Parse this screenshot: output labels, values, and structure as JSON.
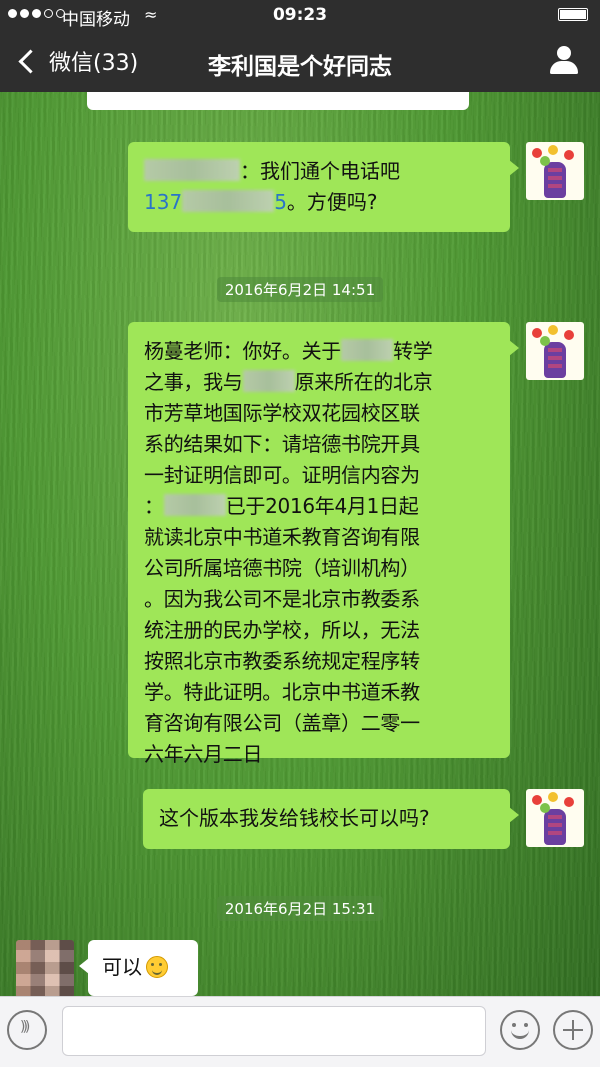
{
  "status_bar": {
    "carrier": "中国移动",
    "time": "09:23",
    "signal_strength": "3 of 5",
    "wifi_icon": "wifi-icon",
    "battery_icon": "battery-icon"
  },
  "nav": {
    "back_label": "微信(33)",
    "title": "李利国是个好同志",
    "profile_icon": "person-icon"
  },
  "messages": {
    "msg1": {
      "line1_suffix": "：我们通个电话吧",
      "phone_prefix": "137",
      "phone_suffix": "5",
      "line2_suffix": "。方便吗?"
    },
    "timestamp1": "2016年6月2日 14:51",
    "msg2": {
      "l1a": "杨蔓老师：你好。关于",
      "l1b": "转学",
      "l2a": "之事，我与",
      "l2b": "原来所在的北京",
      "l3": "市芳草地国际学校双花园校区联",
      "l4": "系的结果如下：请培德书院开具",
      "l5": "一封证明信即可。证明信内容为",
      "l6a": "：",
      "l6b": "已于2016年4月1日起",
      "l7": "就读北京中书道禾教育咨询有限",
      "l8": "公司所属培德书院（培训机构）",
      "l9": "。因为我公司不是北京市教委系",
      "l10": "统注册的民办学校，所以，无法",
      "l11": "按照北京市教委系统规定程序转",
      "l12": "学。特此证明。北京中书道禾教",
      "l13": "育咨询有限公司（盖章）二零一",
      "l14": "六年六月二日"
    },
    "msg3": "这个版本我发给钱校长可以吗?",
    "timestamp2": "2016年6月2日 15:31",
    "msg4": "可以"
  },
  "input_bar": {
    "voice_icon": "voice-icon",
    "emoji_icon": "emoji-icon",
    "plus_icon": "plus-icon",
    "text_value": ""
  },
  "colors": {
    "bubble_out": "#9fe658",
    "bubble_in": "#ffffff",
    "bar_dark": "#2e2e2e",
    "link": "#2a74c9"
  }
}
